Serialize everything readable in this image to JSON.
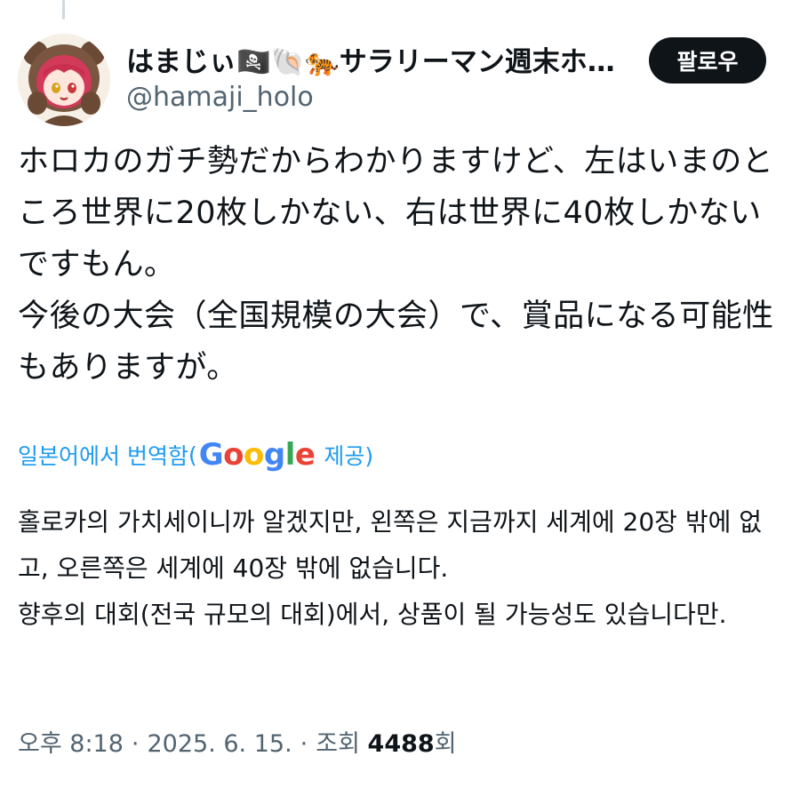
{
  "user": {
    "display_name": "はまじぃ🏴‍☠️🐚🐅サラリーマン週末ホ…",
    "handle": "@hamaji_holo",
    "avatar_icon": "anime-girl-avatar-icon"
  },
  "follow_button": {
    "label": "팔로우"
  },
  "post": {
    "lines": [
      "ホロカのガチ勢だからわかりますけど、左はいまのところ世界に20枚しかない、右は世界に40枚しかないですもん。",
      "今後の大会（全国規模の大会）で、賞品になる可能性もありますが。"
    ]
  },
  "translation": {
    "link_label": "일본어에서 번역함",
    "open_paren": "(",
    "google_letters": [
      "G",
      "o",
      "o",
      "g",
      "l",
      "e"
    ],
    "suffix": "제공)",
    "lines": [
      "홀로카의 가치세이니까 알겠지만, 왼쪽은 지금까지 세계에 20장 밖에 없고, 오른쪽은 세계에 40장 밖에 없습니다.",
      "향후의 대회(전국 규모의 대회)에서, 상품이 될 가능성도 있습니다만."
    ]
  },
  "meta": {
    "time": "오후 8:18",
    "separator": "·",
    "date": "2025. 6. 15.",
    "views_label": "조회",
    "views_count": "4488",
    "views_suffix": "회"
  },
  "colors": {
    "text": "#0f1419",
    "secondary": "#536471",
    "link": "#1d9bf0",
    "follow_bg": "#0f1419"
  }
}
